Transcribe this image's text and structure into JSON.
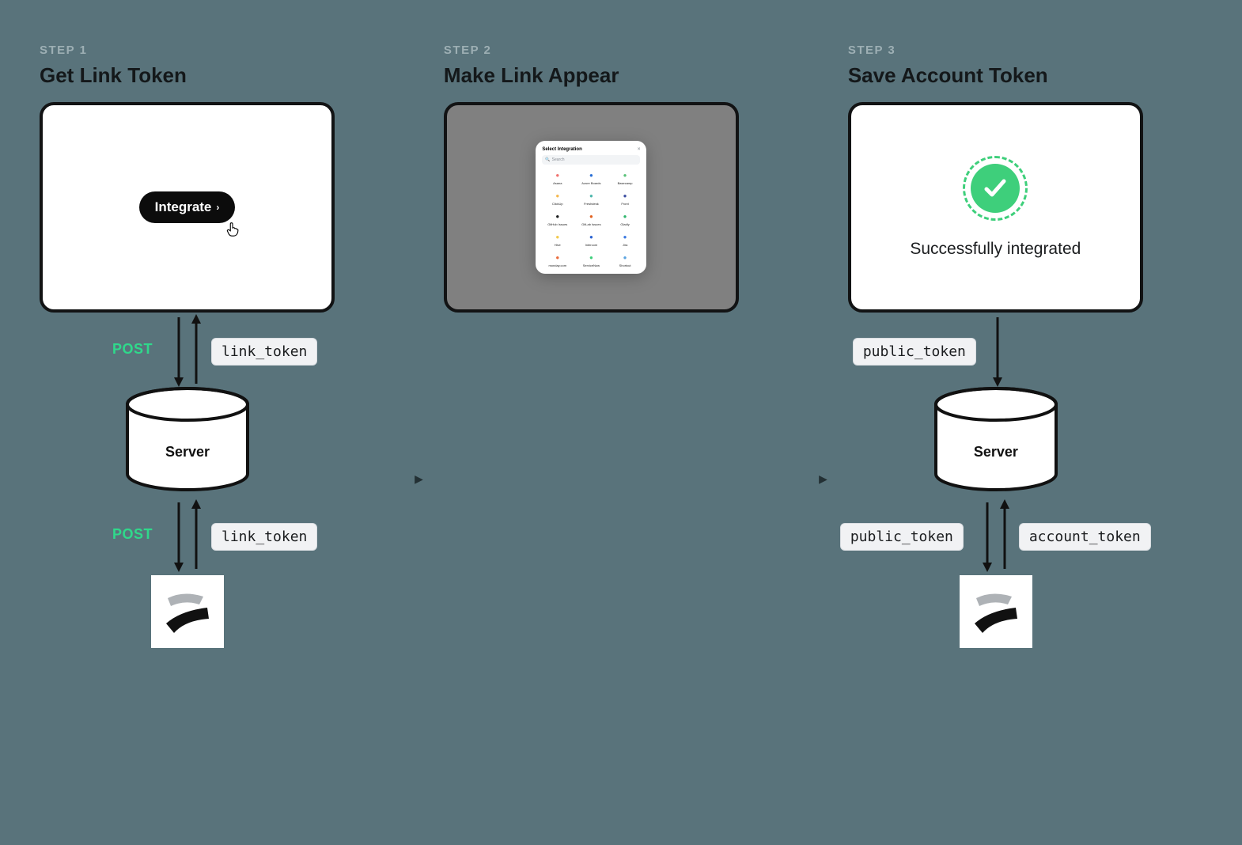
{
  "steps": [
    {
      "label": "STEP 1",
      "title": "Get Link Token"
    },
    {
      "label": "STEP 2",
      "title": "Make Link Appear"
    },
    {
      "label": "STEP 3",
      "title": "Save Account Token"
    }
  ],
  "integrate_button": "Integrate",
  "modal": {
    "title": "Select Integration",
    "search_placeholder": "Search",
    "items": [
      "Asana",
      "Azure Boards",
      "Basecamp",
      "ClickUp",
      "Freshdesk",
      "Front",
      "GitHub Issues",
      "GitLab Issues",
      "Gladly",
      "Hive",
      "Intercom",
      "Jira",
      "monday.com",
      "ServiceNow",
      "Shortcut"
    ]
  },
  "success_text": "Successfully integrated",
  "server_label": "Server",
  "tokens": {
    "link": "link_token",
    "public": "public_token",
    "account": "account_token"
  },
  "post_label": "POST",
  "icon_colors": [
    "#f0726f",
    "#2a6fd6",
    "#5bc27a",
    "#f5b84d",
    "#4db6ac",
    "#3b4da1",
    "#1b1d1f",
    "#e26321",
    "#2fb66d",
    "#f2c94c",
    "#2962d1",
    "#3a78e0",
    "#eb6b3b",
    "#3ecf7b",
    "#5ca4e0"
  ]
}
